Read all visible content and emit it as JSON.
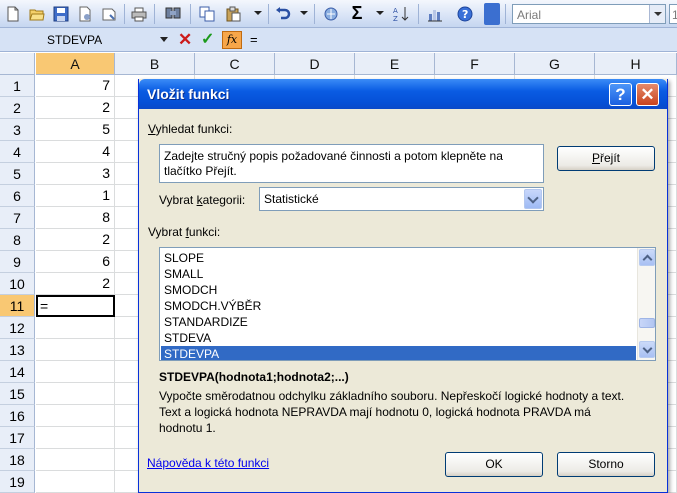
{
  "toolbar": {
    "font_name": "Arial",
    "font_size": "1"
  },
  "formula_bar": {
    "name_box": "STDEVPA",
    "cancel_glyph": "✕",
    "enter_glyph": "✓",
    "fx_label": "fx",
    "content": "="
  },
  "grid": {
    "columns": [
      "A",
      "B",
      "C",
      "D",
      "E",
      "F",
      "G",
      "H"
    ],
    "rows": [
      "1",
      "2",
      "3",
      "4",
      "5",
      "6",
      "7",
      "8",
      "9",
      "10",
      "11",
      "12",
      "13",
      "14",
      "15",
      "16",
      "17",
      "18",
      "19"
    ],
    "column_a_values": [
      "7",
      "2",
      "5",
      "4",
      "3",
      "1",
      "8",
      "2",
      "6",
      "2"
    ],
    "active_cell_value": "="
  },
  "dialog": {
    "title": "Vložit funkci",
    "help_glyph": "?",
    "close_glyph": "✕",
    "search_label_pre": "",
    "search_label_u": "V",
    "search_label_post": "yhledat funkci:",
    "search_text": "Zadejte stručný popis požadované činnosti a potom klepněte na tlačítko Přejít.",
    "go_button_pre": "",
    "go_button_u": "P",
    "go_button_post": "řejít",
    "category_label_pre": "Vybrat ",
    "category_label_u": "k",
    "category_label_post": "ategorii:",
    "category_value": "Statistické",
    "function_label_pre": "Vybrat ",
    "function_label_u": "f",
    "function_label_post": "unkci:",
    "functions": [
      "SLOPE",
      "SMALL",
      "SMODCH",
      "SMODCH.VÝBĚR",
      "STANDARDIZE",
      "STDEVA",
      "STDEVPA"
    ],
    "selected_function": "STDEVPA",
    "syntax": "STDEVPA(hodnota1;hodnota2;...)",
    "description_line1": "Vypočte směrodatnou odchylku základního souboru. Nepřeskočí logické hodnoty a text.",
    "description_line2": "Text a logická hodnota NEPRAVDA mají hodnotu 0, logická hodnota PRAVDA má",
    "description_line3": "hodnotu 1.",
    "help_link": "Nápověda k této funkci",
    "ok_label": "OK",
    "cancel_label": "Storno"
  },
  "colors": {
    "title_bar": "#0550d6",
    "selection": "#316ac5",
    "active_header": "#f9c873"
  }
}
